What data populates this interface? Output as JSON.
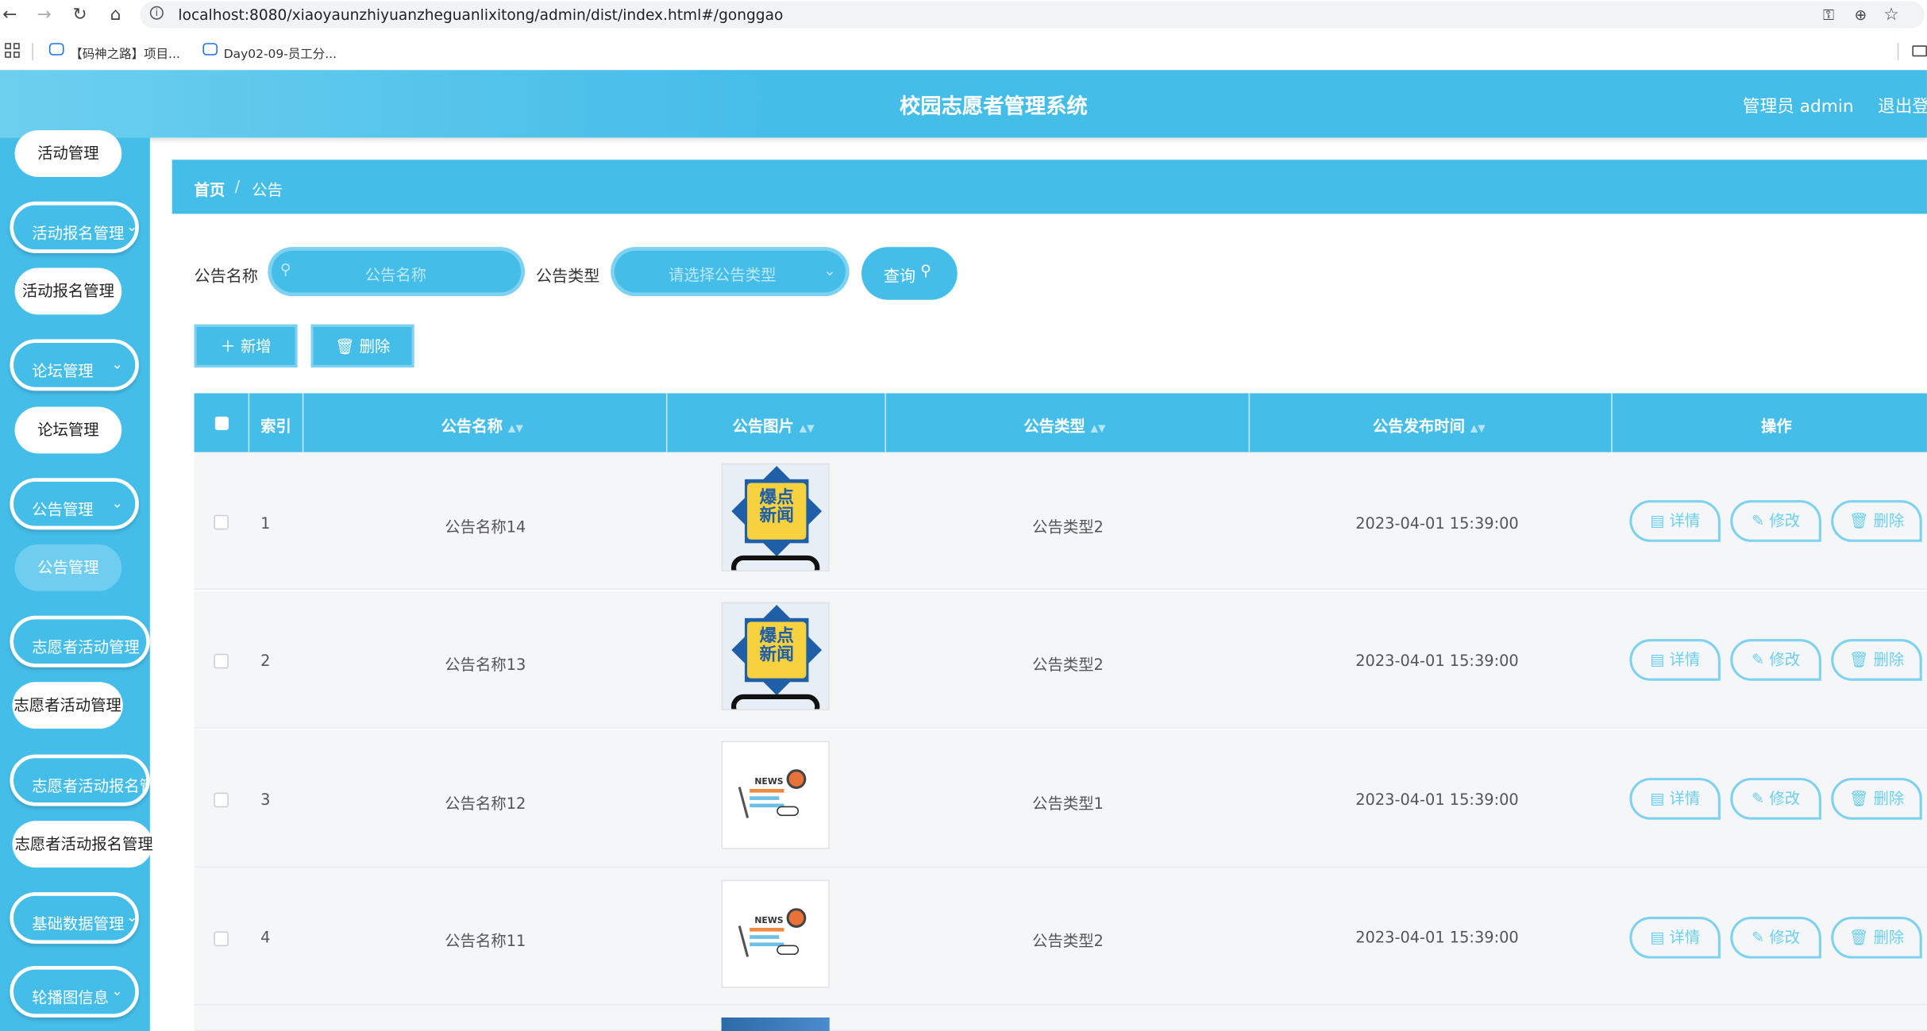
{
  "browser": {
    "url": "localhost:8080/xiaoyaunzhiyuanzheguanlixitong/admin/dist/index.html#/gonggao",
    "bookmarks": [
      {
        "label": "【码神之路】项目..."
      },
      {
        "label": "Day02-09-员工分..."
      }
    ]
  },
  "header": {
    "title": "校园志愿者管理系统",
    "admin_label": "管理员 admin",
    "logout_label": "退出登"
  },
  "sidebar": {
    "items": [
      {
        "label": "活动管理",
        "kind": "child"
      },
      {
        "label": "活动报名管理",
        "kind": "parent"
      },
      {
        "label": "活动报名管理",
        "kind": "child"
      },
      {
        "label": "论坛管理",
        "kind": "parent"
      },
      {
        "label": "论坛管理",
        "kind": "child"
      },
      {
        "label": "公告管理",
        "kind": "parent"
      },
      {
        "label": "公告管理",
        "kind": "child-active"
      },
      {
        "label": "志愿者活动管理",
        "kind": "parent"
      },
      {
        "label": "志愿者活动管理",
        "kind": "child"
      },
      {
        "label": "志愿者活动报名管",
        "kind": "parent"
      },
      {
        "label": "志愿者活动报名管理",
        "kind": "child"
      },
      {
        "label": "基础数据管理",
        "kind": "parent"
      },
      {
        "label": "轮播图信息",
        "kind": "parent"
      }
    ]
  },
  "breadcrumb": {
    "home": "首页",
    "separator": "/",
    "current": "公告"
  },
  "search": {
    "name_label": "公告名称",
    "name_placeholder": "公告名称",
    "type_label": "公告类型",
    "type_placeholder": "请选择公告类型",
    "query_label": "查询"
  },
  "actions": {
    "add_label": "新增",
    "delete_label": "删除"
  },
  "table": {
    "columns": [
      "索引",
      "公告名称",
      "公告图片",
      "公告类型",
      "公告发布时间",
      "操作"
    ],
    "rows": [
      {
        "index": "1",
        "name": "公告名称14",
        "image": "breaking-news",
        "type": "公告类型2",
        "time": "2023-04-01 15:39:00"
      },
      {
        "index": "2",
        "name": "公告名称13",
        "image": "breaking-news",
        "type": "公告类型2",
        "time": "2023-04-01 15:39:00"
      },
      {
        "index": "3",
        "name": "公告名称12",
        "image": "newspaper",
        "type": "公告类型1",
        "time": "2023-04-01 15:39:00"
      },
      {
        "index": "4",
        "name": "公告名称11",
        "image": "newspaper",
        "type": "公告类型2",
        "time": "2023-04-01 15:39:00"
      }
    ],
    "row_actions": {
      "detail": "详情",
      "edit": "修改",
      "delete": "删除"
    },
    "thumb_text": {
      "line1": "爆点",
      "line2": "新闻",
      "news": "NEWS"
    }
  },
  "colors": {
    "primary": "#45bde9",
    "light": "#7fd2ef",
    "row_bg": "#f4f6f8"
  }
}
